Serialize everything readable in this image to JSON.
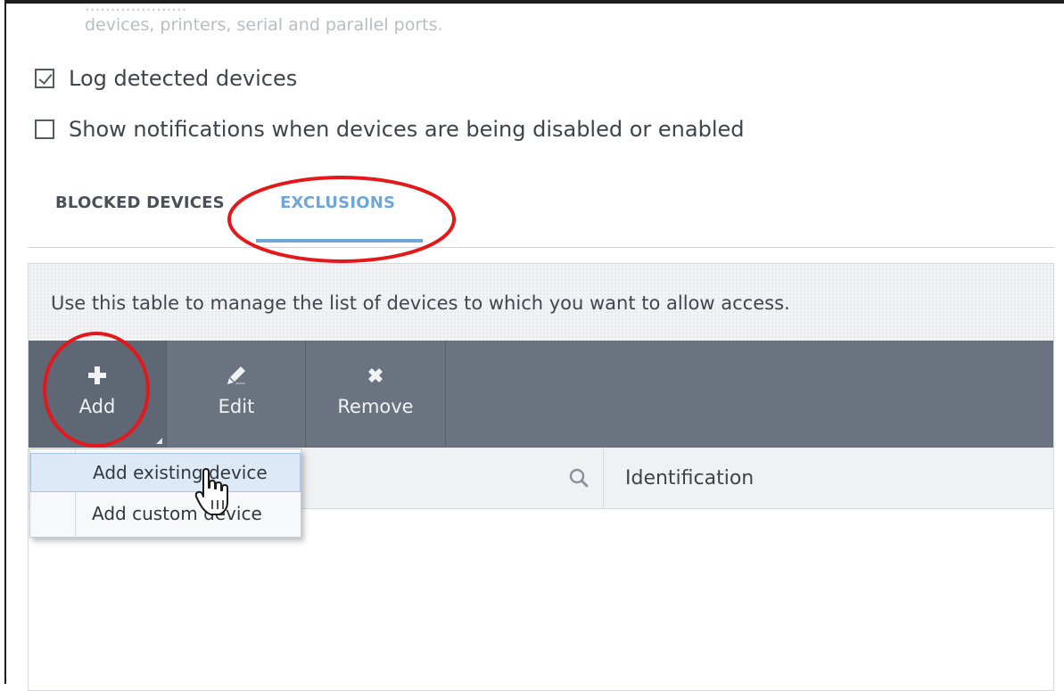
{
  "description_text": {
    "partial_line": "....................",
    "line": "devices, printers, serial and parallel ports."
  },
  "options": {
    "log_detected": {
      "label": "Log detected devices",
      "checked": true
    },
    "show_notifications": {
      "label": "Show notifications when devices are being disabled or enabled",
      "checked": false
    }
  },
  "tabs": [
    {
      "label": "BLOCKED DEVICES",
      "active": false
    },
    {
      "label": "EXCLUSIONS",
      "active": true
    }
  ],
  "panel": {
    "info_text": "Use this table to manage the list of devices to which you want to allow access."
  },
  "toolbar": {
    "add_label": "Add",
    "edit_label": "Edit",
    "remove_label": "Remove"
  },
  "table": {
    "columns": [
      "",
      "Identification"
    ]
  },
  "add_menu": {
    "items": [
      "Add existing device",
      "Add custom device"
    ]
  },
  "colors": {
    "accent": "#6fa6d8",
    "toolbar": "#6b7280",
    "annotation": "#e3181b"
  }
}
